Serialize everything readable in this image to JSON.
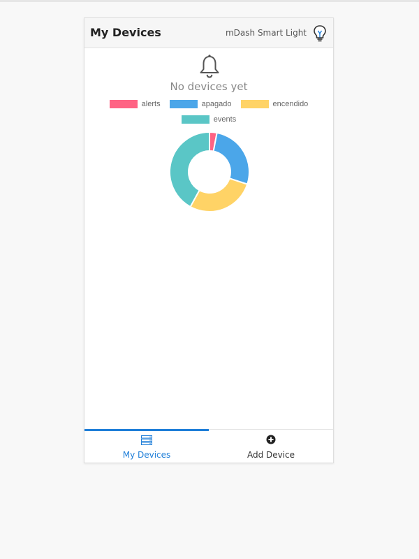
{
  "header": {
    "title": "My Devices",
    "subtitle": "mDash Smart Light"
  },
  "main": {
    "empty_text": "No devices yet"
  },
  "chart_data": {
    "type": "pie",
    "categories": [
      "alerts",
      "apagado",
      "encendido",
      "events"
    ],
    "values": [
      3,
      27,
      28,
      42
    ],
    "colors": [
      "#ff6384",
      "#4ba6e9",
      "#ffd366",
      "#5ac6c6"
    ],
    "legend_position": "top"
  },
  "bottom_nav": {
    "tabs": [
      {
        "label": "My Devices",
        "icon": "devices-list-icon",
        "active": true
      },
      {
        "label": "Add Device",
        "icon": "plus-circle-icon",
        "active": false
      }
    ]
  },
  "colors": {
    "accent": "#1e7ed8"
  }
}
